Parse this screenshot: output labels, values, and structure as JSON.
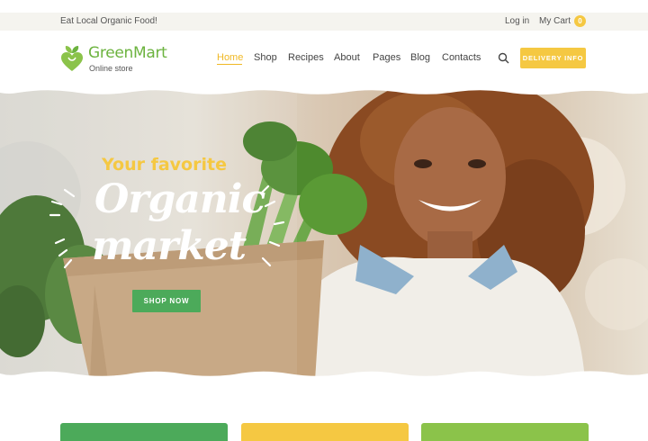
{
  "topbar": {
    "tagline": "Eat Local Organic Food!",
    "login_label": "Log in",
    "cart_label": "My Cart",
    "cart_count": "0"
  },
  "brand": {
    "name": "GreenMart",
    "subtitle": "Online store",
    "color": "#6cb33f"
  },
  "nav": {
    "items": [
      {
        "label": "Home",
        "active": true
      },
      {
        "label": "Shop"
      },
      {
        "label": "Recipes"
      },
      {
        "label": "About"
      },
      {
        "label": "Pages"
      },
      {
        "label": "Blog"
      },
      {
        "label": "Contacts"
      }
    ],
    "search_icon": "search-icon",
    "delivery_label": "DELIVERY INFO"
  },
  "hero": {
    "kicker": "Your favorite",
    "headline_line1": "Organic",
    "headline_line2": "market",
    "cta_label": "SHOP NOW"
  },
  "colors": {
    "accent_yellow": "#f5c842",
    "accent_green": "#4caa5a",
    "light_green": "#8bc34a"
  }
}
